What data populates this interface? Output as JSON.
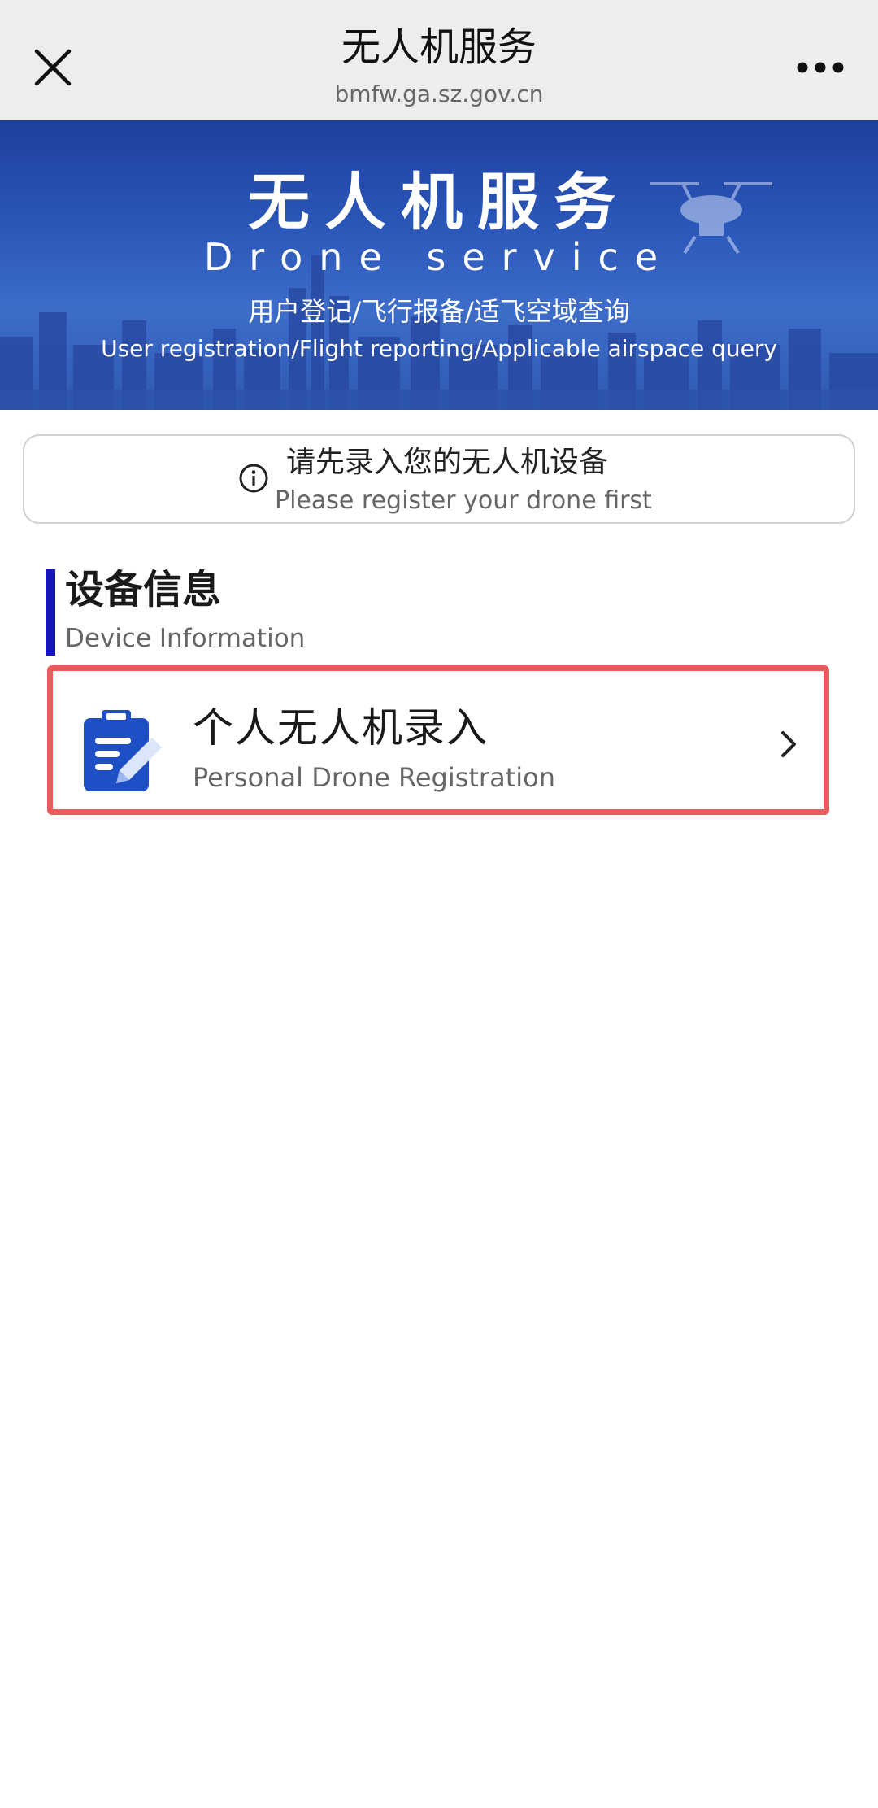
{
  "nav": {
    "title": "无人机服务",
    "url": "bmfw.ga.sz.gov.cn",
    "close_icon": "close-icon",
    "more_icon": "more-icon"
  },
  "banner": {
    "title_cn": "无人机服务",
    "title_en": "Drone service",
    "subtitle_cn": "用户登记/飞行报备/适飞空域查询",
    "subtitle_en": "User registration/Flight reporting/Applicable airspace query"
  },
  "notice": {
    "icon": "info-icon",
    "text_cn": "请先录入您的无人机设备",
    "text_en": "Please register your drone first"
  },
  "section": {
    "title_cn": "设备信息",
    "title_en": "Device Information",
    "accent_color": "#1515b8"
  },
  "registration_item": {
    "icon": "clipboard-edit-icon",
    "title_cn": "个人无人机录入",
    "title_en": "Personal Drone Registration",
    "chevron_icon": "chevron-right-icon",
    "highlight_color": "#ec5a5e",
    "icon_color": "#1f4fc4"
  }
}
